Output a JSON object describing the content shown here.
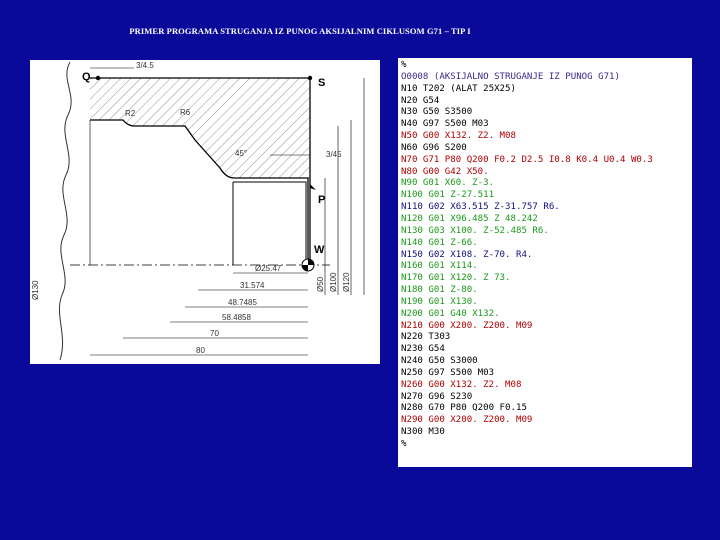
{
  "title": "PRIMER PROGRAMA STRUGANJA IZ PUNOG AKSIJALNIM CIKLUSOM G71 – TIP I",
  "drawing": {
    "point_q": "Q",
    "point_s": "S",
    "point_p": "P",
    "point_w": "W",
    "dim_top": "3/4.5",
    "dim_r2": "R2",
    "dim_r6": "R6",
    "dim_45": "45°",
    "dim_right": "3/45",
    "dim_h1": "Ø25.47",
    "dim_h2": "31.574",
    "dim_h3": "48.7485",
    "dim_h4": "58.4858",
    "dim_h5": "70",
    "dim_h6": "80",
    "dim_v1": "Ø130",
    "dim_v2": "Ø50",
    "dim_v3": "Ø100",
    "dim_v4": "Ø120"
  },
  "program": [
    {
      "text": "%",
      "color": "black"
    },
    {
      "text": "O0008 (AKSIJALNO STRUGANJE IZ PUNOG G71)",
      "color": "purple"
    },
    {
      "text": "N10 T202 (ALAT 25X25)",
      "color": "black"
    },
    {
      "text": "N20 G54",
      "color": "black"
    },
    {
      "text": "N30 G50 S3500",
      "color": "black"
    },
    {
      "text": "N40 G97 S500 M03",
      "color": "black"
    },
    {
      "text": "N50 G00 X132. Z2. M08",
      "color": "red"
    },
    {
      "text": "N60 G96 S200",
      "color": "black"
    },
    {
      "text": "N70 G71 P80 Q200 F0.2 D2.5 I0.8 K0.4 U0.4 W0.3",
      "color": "red"
    },
    {
      "text": "N80 G00 G42 X50.",
      "color": "red"
    },
    {
      "text": "N90 G01 X60. Z-3.",
      "color": "green"
    },
    {
      "text": "N100 G01 Z-27.511",
      "color": "green"
    },
    {
      "text": "N110 G02 X63.515 Z-31.757 R6.",
      "color": "blue"
    },
    {
      "text": "N120 G01 X96.485 Z 48.242",
      "color": "green"
    },
    {
      "text": "N130 G03 X100. Z-52.485 R6.",
      "color": "green"
    },
    {
      "text": "N140 G01 Z-66.",
      "color": "green"
    },
    {
      "text": "N150 G02 X108. Z-70. R4.",
      "color": "blue"
    },
    {
      "text": "N160 G01 X114.",
      "color": "green"
    },
    {
      "text": "N170 G01 X120. Z 73.",
      "color": "green"
    },
    {
      "text": "N180 G01 Z-80.",
      "color": "green"
    },
    {
      "text": "N190 G01 X130.",
      "color": "green"
    },
    {
      "text": "N200 G01 G40 X132.",
      "color": "green"
    },
    {
      "text": "N210 G00 X200. Z200. M09",
      "color": "red"
    },
    {
      "text": "N220 T303",
      "color": "black"
    },
    {
      "text": "N230 G54",
      "color": "black"
    },
    {
      "text": "N240 G50 S3000",
      "color": "black"
    },
    {
      "text": "N250 G97 S500 M03",
      "color": "black"
    },
    {
      "text": "N260 G00 X132. Z2. M08",
      "color": "red"
    },
    {
      "text": "N270 G96 S230",
      "color": "black"
    },
    {
      "text": "N280 G70 P80 Q200 F0.15",
      "color": "black"
    },
    {
      "text": "N290 G00 X200. Z200. M09",
      "color": "red"
    },
    {
      "text": "N300 M30",
      "color": "black"
    },
    {
      "text": "%",
      "color": "black"
    }
  ]
}
